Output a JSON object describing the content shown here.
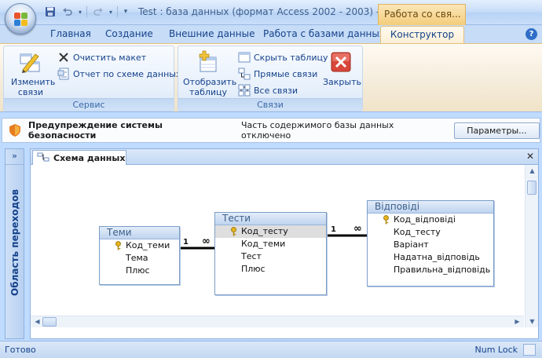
{
  "window": {
    "title": "Test : база данных (формат Access 2002 - 2003) - Mi...",
    "context_tab": "Работа со свя...",
    "controls": {
      "minimize": "–",
      "maximize": "□",
      "close": "✕"
    }
  },
  "qat": {
    "save_icon": "save-icon",
    "undo_icon": "undo-icon",
    "redo_icon": "redo-icon",
    "customize": "▾"
  },
  "tabs": [
    "Главная",
    "Создание",
    "Внешние данные",
    "Работа с базами данных"
  ],
  "active_tab": "Конструктор",
  "help": "?",
  "ribbon": {
    "service": {
      "label": "Сервис",
      "edit": "Изменить связи",
      "clear": "Очистить макет",
      "report": "Отчет по схеме данных"
    },
    "links": {
      "label": "Связи",
      "show_table": "Отобразить таблицу",
      "hide_table": "Скрыть таблицу",
      "direct": "Прямые связи",
      "all": "Все связи",
      "close": "Закрыть"
    }
  },
  "security": {
    "title": "Предупреждение системы безопасности",
    "message": "Часть содержимого базы данных отключено",
    "button": "Параметры..."
  },
  "nav": {
    "toggle": "»",
    "label": "Область переходов"
  },
  "document": {
    "tab": "Схема данных",
    "close": "✕"
  },
  "tables": {
    "temy": {
      "title": "Теми",
      "fields": [
        "Код_теми",
        "Тема",
        "Плюс"
      ]
    },
    "testy": {
      "title": "Тести",
      "fields": [
        "Код_тесту",
        "Код_теми",
        "Тест",
        "Плюс"
      ]
    },
    "vidpovidi": {
      "title": "Відповіді",
      "fields": [
        "Код_відповіді",
        "Код_тесту",
        "Варіант",
        "Надатна_відповідь",
        "Правильна_відповідь"
      ]
    }
  },
  "relations": {
    "one": "1",
    "many": "∞"
  },
  "status": {
    "left": "Готово",
    "right": "Num Lock"
  }
}
